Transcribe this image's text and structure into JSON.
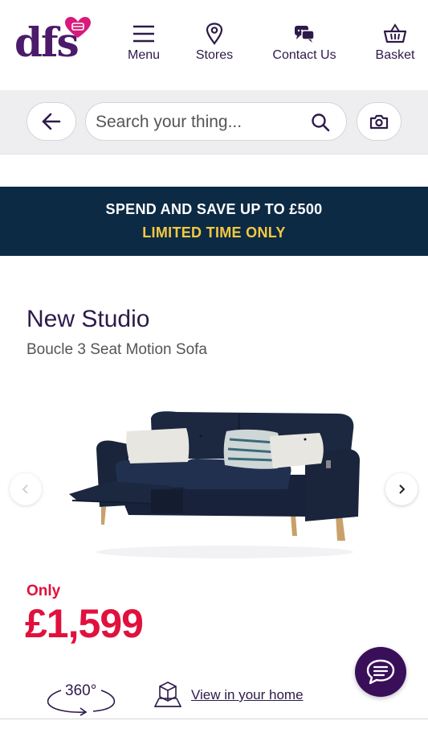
{
  "header": {
    "logo_text": "dfs",
    "nav": [
      {
        "label": "Menu",
        "icon": "hamburger-icon"
      },
      {
        "label": "Stores",
        "icon": "map-pin-icon"
      },
      {
        "label": "Contact Us",
        "icon": "chat-bubbles-icon"
      },
      {
        "label": "Basket",
        "icon": "basket-icon"
      }
    ]
  },
  "search": {
    "placeholder": "Search your thing...",
    "value": ""
  },
  "promo": {
    "line1": "SPEND AND SAVE UP TO £500",
    "line2": "LIMITED TIME ONLY"
  },
  "product": {
    "title": "New Studio",
    "subtitle": "Boucle 3 Seat Motion Sofa",
    "price_label": "Only",
    "price": "£1,599"
  },
  "media": {
    "view360_label": "360°",
    "ar_label": "View in your home"
  },
  "colors": {
    "brand_purple": "#4c1a6b",
    "promo_bg": "#0c2a44",
    "promo_accent": "#f5c842",
    "price_red": "#e0113d"
  }
}
